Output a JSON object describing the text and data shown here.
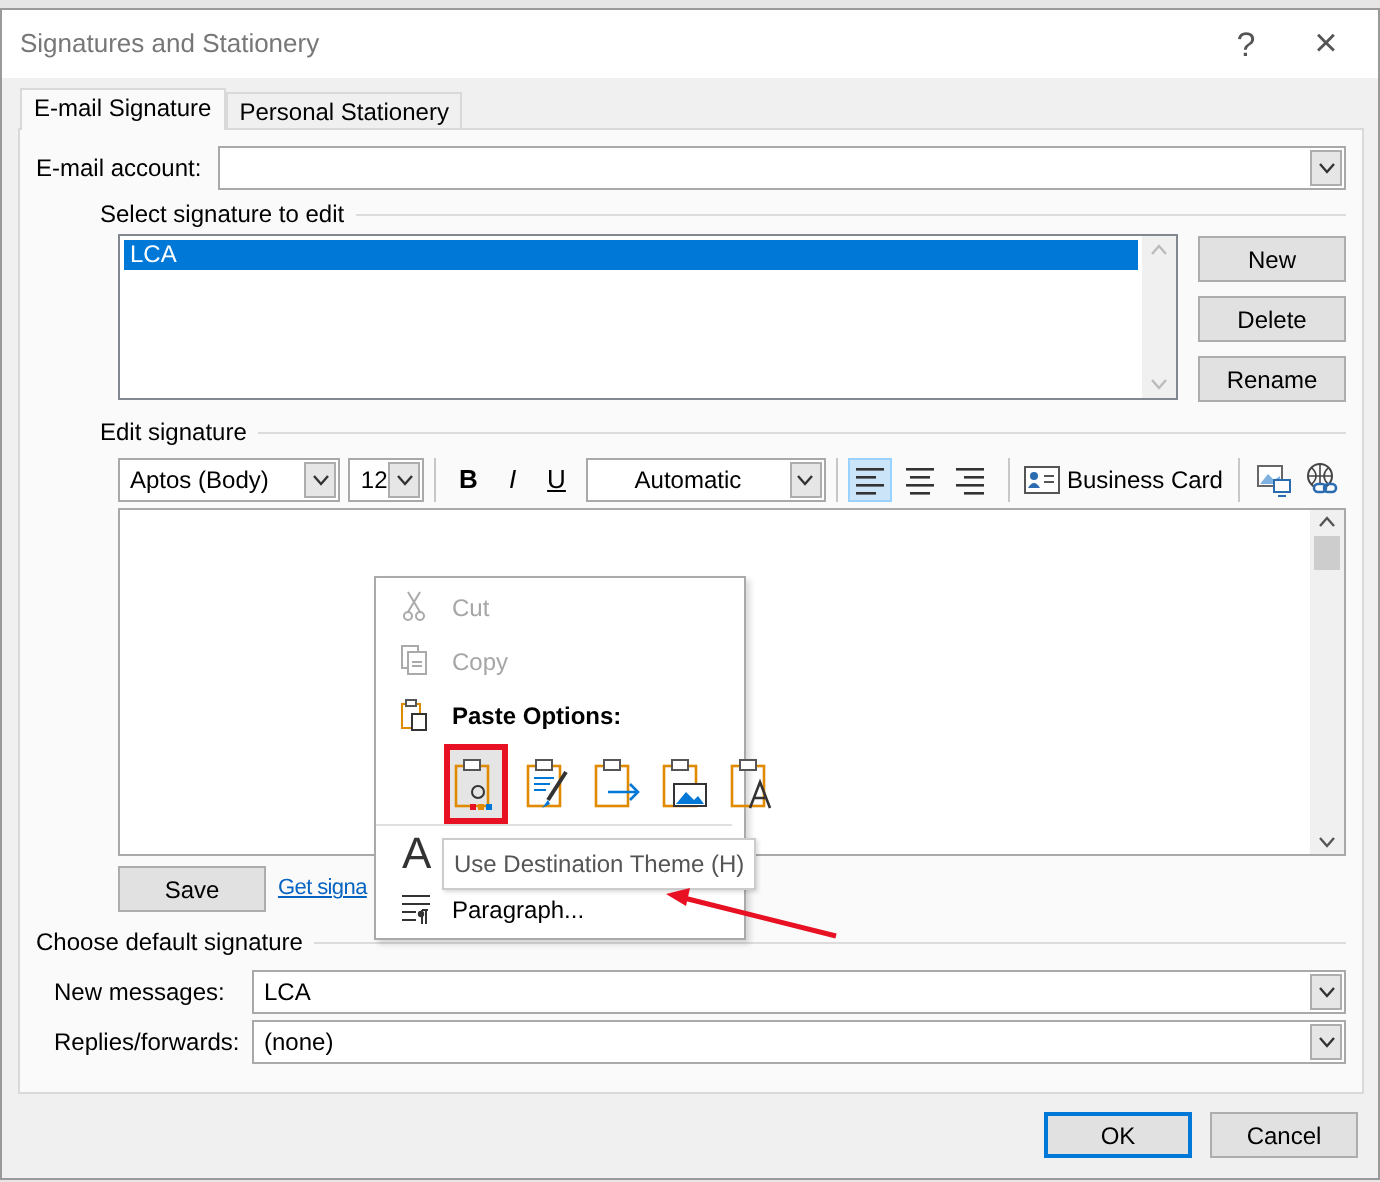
{
  "window": {
    "title": "Signatures and Stationery",
    "help": "?",
    "close": "×"
  },
  "tabs": [
    {
      "label": "E-mail Signature",
      "selected": true
    },
    {
      "label": "Personal Stationery",
      "selected": false
    }
  ],
  "email_account": {
    "label": "E-mail account:"
  },
  "select_signature": {
    "legend": "Select signature to edit",
    "items": [
      {
        "label": "LCA",
        "selected": true
      }
    ],
    "buttons": [
      "New",
      "Delete",
      "Rename"
    ]
  },
  "edit_signature": {
    "legend": "Edit signature",
    "toolbar": {
      "font": "Aptos (Body)",
      "size": "12",
      "bold": "B",
      "italic": "I",
      "underline": "U",
      "font_color": "Automatic",
      "alignment": [
        {
          "kind": "left",
          "selected": true
        },
        {
          "kind": "center",
          "selected": false
        },
        {
          "kind": "right",
          "selected": false
        }
      ],
      "business_card": "Business Card"
    },
    "save": "Save",
    "link": "Get signa"
  },
  "context_menu": {
    "items": [
      {
        "kind": "cut",
        "label": "Cut",
        "disabled": true
      },
      {
        "kind": "copy",
        "label": "Copy",
        "disabled": true
      },
      {
        "kind": "header",
        "label": "Paste Options:"
      },
      {
        "kind": "paste_options",
        "options": [
          {
            "kind": "theme",
            "selected": true
          },
          {
            "kind": "formatting",
            "selected": false
          },
          {
            "kind": "merge",
            "selected": false
          },
          {
            "kind": "picture",
            "selected": false
          },
          {
            "kind": "text",
            "selected": false
          }
        ]
      },
      {
        "kind": "font_item",
        "glyph": "A"
      },
      {
        "kind": "paragraph",
        "label": "Paragraph...",
        "disabled": false
      }
    ]
  },
  "tooltip": "Use Destination Theme (H)",
  "default_signature": {
    "legend": "Choose default signature",
    "fields": [
      {
        "label": "New messages:",
        "value": "LCA"
      },
      {
        "label": "Replies/forwards:",
        "value": "(none)"
      }
    ]
  },
  "buttons": [
    {
      "label": "OK",
      "default": true
    },
    {
      "label": "Cancel",
      "default": false
    }
  ]
}
